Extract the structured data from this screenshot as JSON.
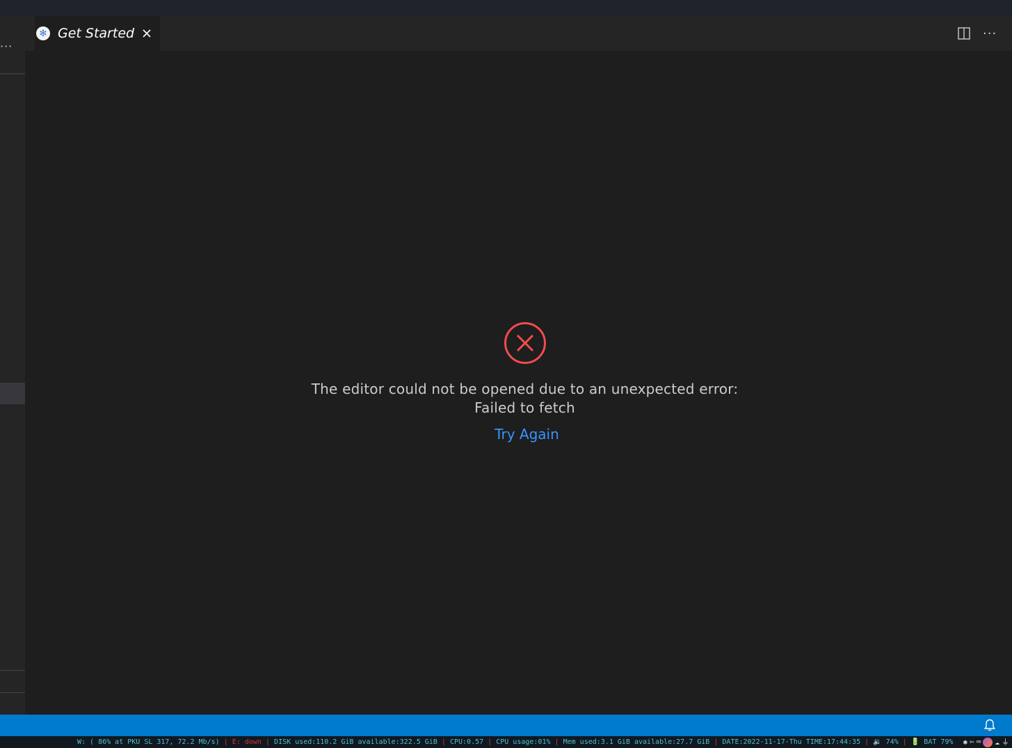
{
  "sidebar": {
    "more_label": "···"
  },
  "tab": {
    "label": "Get Started"
  },
  "tab_actions": {
    "more_label": "···"
  },
  "error": {
    "line1": "The editor could not be opened due to an unexpected error:",
    "line2": "Failed to fetch",
    "retry_label": "Try Again",
    "icon_color": "#f14c4c",
    "link_color": "#3794ff"
  },
  "statusbar": {
    "color": "#007acc",
    "icon": "bell-icon"
  },
  "system_bar": {
    "wireless": "W: ( 86% at PKU SL 317, 72.2 Mb/s)",
    "ethernet": "E: down",
    "disk": "DISK used:110.2 GiB available:322.5 GiB",
    "cpu_load": "CPU:0.57",
    "cpu_usage": "CPU usage:01%",
    "memory": "Mem used:3.1 GiB available:27.7 GiB",
    "datetime": "DATE:2022-11-17-Thu TIME:17:44:35",
    "volume": "🔉 74%",
    "battery": "🔋 BAT 79%",
    "separator": "|"
  }
}
